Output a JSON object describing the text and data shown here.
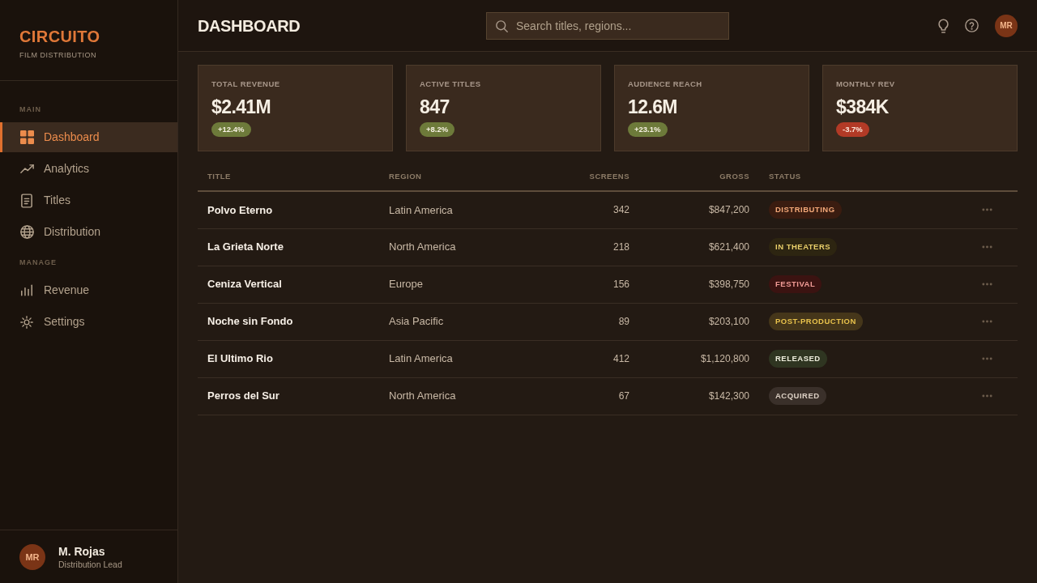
{
  "sidebar": {
    "brand": {
      "name": "CIRCUITO",
      "tagline": "FILM DISTRIBUTION"
    },
    "sections": [
      {
        "label": "MAIN",
        "items": [
          {
            "label": "Dashboard",
            "selected": true
          },
          {
            "label": "Analytics",
            "selected": false
          },
          {
            "label": "Titles",
            "selected": false
          },
          {
            "label": "Distribution",
            "selected": false
          }
        ]
      },
      {
        "label": "MANAGE",
        "items": [
          {
            "label": "Revenue",
            "selected": false
          },
          {
            "label": "Settings",
            "selected": false
          }
        ]
      }
    ],
    "user": {
      "initials": "MR",
      "name": "M. Rojas",
      "role": "Distribution Lead"
    }
  },
  "header": {
    "title": "DASHBOARD",
    "search": {
      "placeholder": "Search titles, regions..."
    },
    "avatar": {
      "initials": "MR"
    }
  },
  "stats": [
    {
      "label": "TOTAL REVENUE",
      "value": "$2.41M",
      "change": "+12.4%",
      "kind": "gain"
    },
    {
      "label": "ACTIVE TITLES",
      "value": "847",
      "change": "+8.2%",
      "kind": "gain"
    },
    {
      "label": "AUDIENCE REACH",
      "value": "12.6M",
      "change": "+23.1%",
      "kind": "gain"
    },
    {
      "label": "MONTHLY REV",
      "value": "$384K",
      "change": "-3.7%",
      "kind": "loss"
    }
  ],
  "table": {
    "columns": [
      "TITLE",
      "REGION",
      "SCREENS",
      "GROSS",
      "STATUS"
    ],
    "rows": [
      {
        "title": "Polvo Eterno",
        "region": "Latin America",
        "screens": "342",
        "gross": "$847,200",
        "status": {
          "label": "DISTRIBUTING",
          "kind": "distributing"
        }
      },
      {
        "title": "La Grieta Norte",
        "region": "North America",
        "screens": "218",
        "gross": "$621,400",
        "status": {
          "label": "IN THEATERS",
          "kind": "theatrical"
        }
      },
      {
        "title": "Ceniza Vertical",
        "region": "Europe",
        "screens": "156",
        "gross": "$398,750",
        "status": {
          "label": "FESTIVAL",
          "kind": "festival"
        }
      },
      {
        "title": "Noche sin Fondo",
        "region": "Asia Pacific",
        "screens": "89",
        "gross": "$203,100",
        "status": {
          "label": "POST-PRODUCTION",
          "kind": "postproduction"
        }
      },
      {
        "title": "El Ultimo Rio",
        "region": "Latin America",
        "screens": "412",
        "gross": "$1,120,800",
        "status": {
          "label": "RELEASED",
          "kind": "released"
        }
      },
      {
        "title": "Perros del Sur",
        "region": "North America",
        "screens": "67",
        "gross": "$142,300",
        "status": {
          "label": "ACQUIRED",
          "kind": "acquired"
        }
      }
    ]
  }
}
